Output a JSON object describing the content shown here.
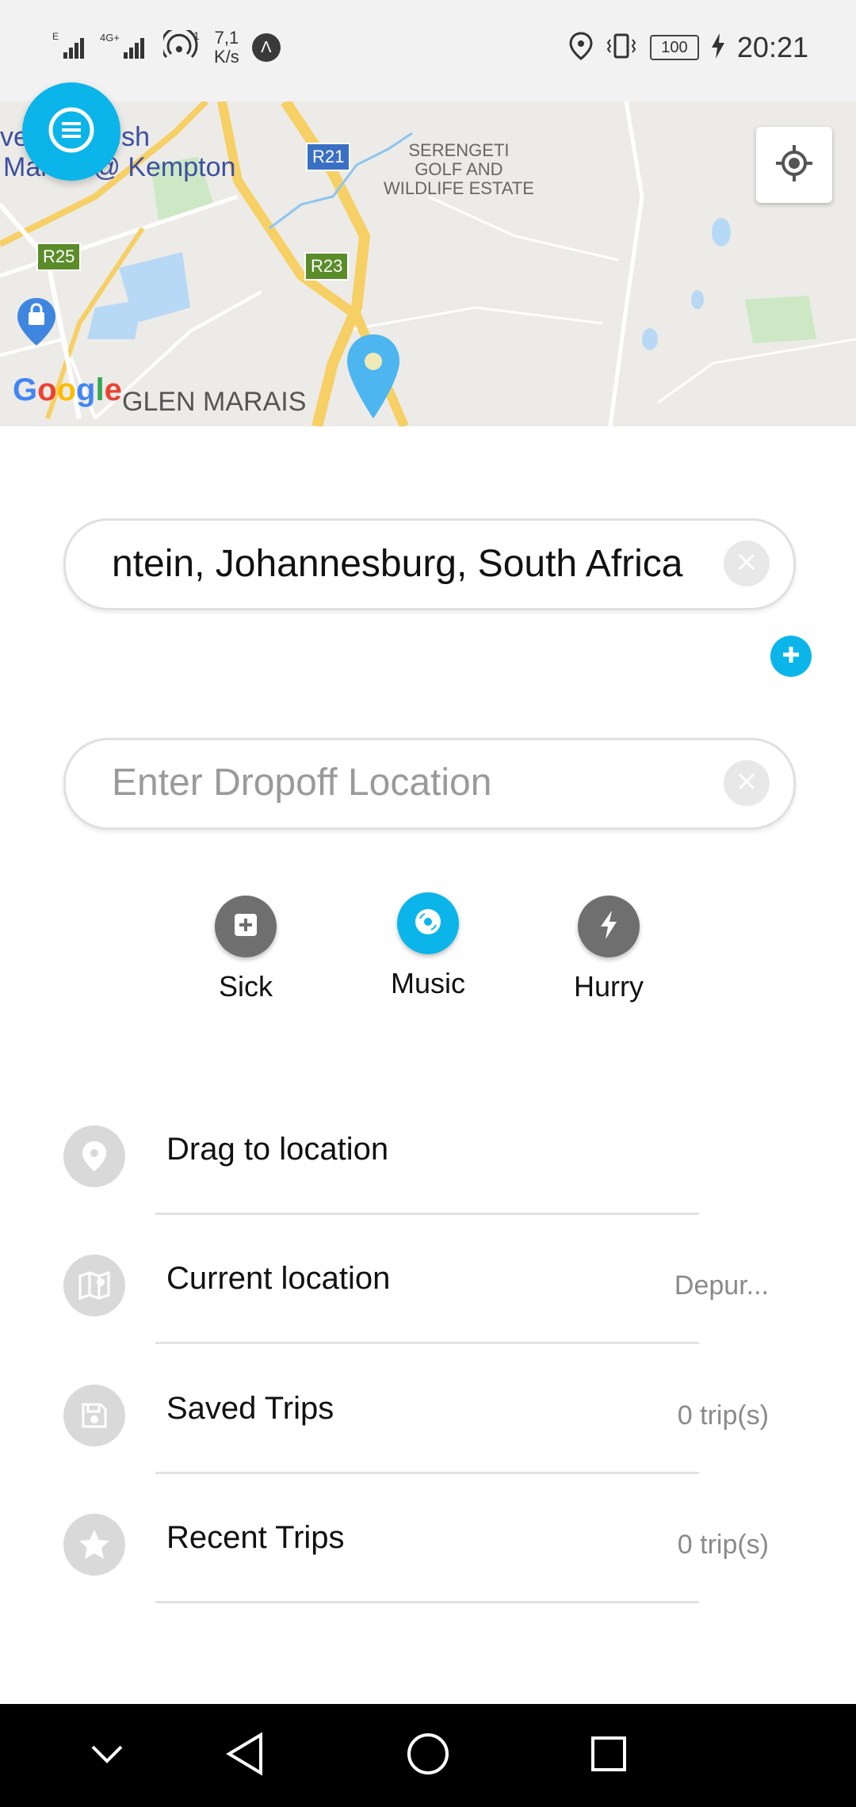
{
  "status_bar": {
    "signal_1": "E",
    "signal_2": "4G+",
    "hotspot_count": "1",
    "speed_value": "7,1",
    "speed_unit": "K/s",
    "battery": "100",
    "time": "20:21"
  },
  "map": {
    "labels": {
      "fresh_market": "the Fresh",
      "fresh_market_2": "Market @ Kempton",
      "serengeti": "SERENGETI\nGOLF AND\nWILDLIFE ESTATE",
      "glen_marais": "GLEN MARAIS",
      "google": "Google"
    },
    "roads": [
      "R21",
      "R23",
      "R25"
    ]
  },
  "pickup": {
    "value": "ntein, Johannesburg, South Africa"
  },
  "dropoff": {
    "placeholder": "Enter Dropoff Location"
  },
  "preferences": [
    {
      "label": "Sick",
      "icon": "plus-box-icon",
      "color": "#6f6f6f"
    },
    {
      "label": "Music",
      "icon": "disc-icon",
      "color": "#0bb5ea"
    },
    {
      "label": "Hurry",
      "icon": "lightning-icon",
      "color": "#6f6f6f"
    }
  ],
  "list": [
    {
      "title": "Drag to location",
      "meta": "",
      "icon": "pin-icon"
    },
    {
      "title": "Current location",
      "meta": "Depur...",
      "icon": "map-icon"
    },
    {
      "title": "Saved Trips",
      "meta": "0 trip(s)",
      "icon": "save-icon"
    },
    {
      "title": "Recent Trips",
      "meta": "0 trip(s)",
      "icon": "star-icon"
    }
  ],
  "colors": {
    "accent": "#0bb5ea",
    "grey_icon": "#6f6f6f",
    "list_icon_bg": "#d9d9d9"
  }
}
